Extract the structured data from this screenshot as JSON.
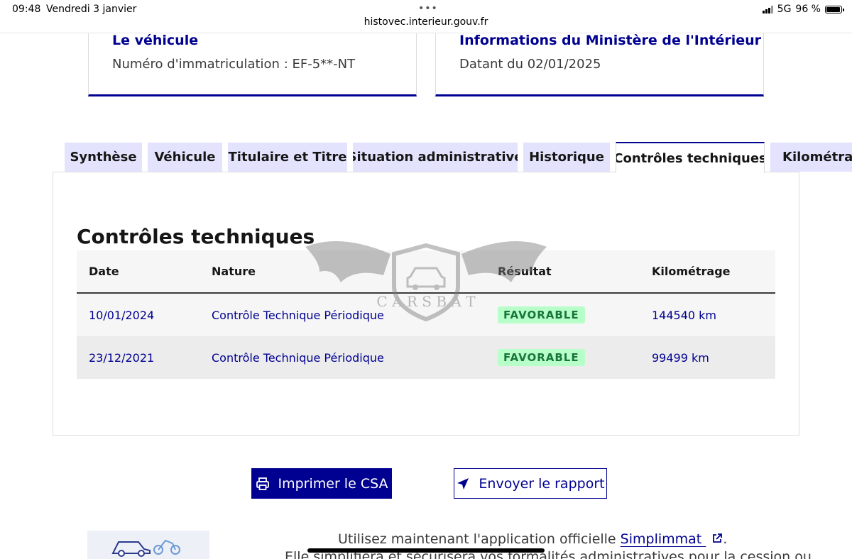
{
  "status_bar": {
    "time": "09:48",
    "date": "Vendredi 3 janvier",
    "url": "histovec.interieur.gouv.fr",
    "network": "5G",
    "battery_text": "96 %",
    "battery_level": 0.96,
    "dots": "•••"
  },
  "cards": {
    "vehicle": {
      "title": "Le véhicule",
      "text": "Numéro d'immatriculation : EF-5**-NT"
    },
    "ministry": {
      "title": "Informations du Ministère de l'Intérieur",
      "text": "Datant du 02/01/2025"
    }
  },
  "tabs": [
    {
      "label": "Synthèse"
    },
    {
      "label": "Véhicule"
    },
    {
      "label": "Titulaire et Titre"
    },
    {
      "label": "Situation administrative"
    },
    {
      "label": "Historique"
    },
    {
      "label": "Contrôles techniques"
    },
    {
      "label": "Kilométrage"
    }
  ],
  "active_tab": "Contrôles techniques",
  "section": {
    "title": "Contrôles techniques"
  },
  "table": {
    "headers": {
      "date": "Date",
      "nature": "Nature",
      "result": "Résultat",
      "km": "Kilométrage"
    },
    "rows": [
      {
        "date": "10/01/2024",
        "nature": "Contrôle Technique Périodique",
        "result": "FAVORABLE",
        "km": "144540 km"
      },
      {
        "date": "23/12/2021",
        "nature": "Contrôle Technique Périodique",
        "result": "FAVORABLE",
        "km": "99499 km"
      }
    ]
  },
  "watermark": {
    "text": "C A R S B A T"
  },
  "buttons": {
    "print": "Imprimer le CSA",
    "send": "Envoyer le rapport"
  },
  "promo": {
    "line1_text": "Utilisez maintenant l'application officielle ",
    "link": "Simplimmat",
    "line1_end": ".",
    "line2": "Elle simplifiera et sécurisera vos formalités administratives pour la cession ou"
  },
  "colors": {
    "primary": "#000091",
    "tab_bg": "#e3e3fd",
    "badge_bg": "#b8fec9",
    "badge_text": "#18753c"
  },
  "icons": {
    "print": "printer-icon",
    "send": "send-arrow-icon",
    "external": "external-link-icon"
  }
}
